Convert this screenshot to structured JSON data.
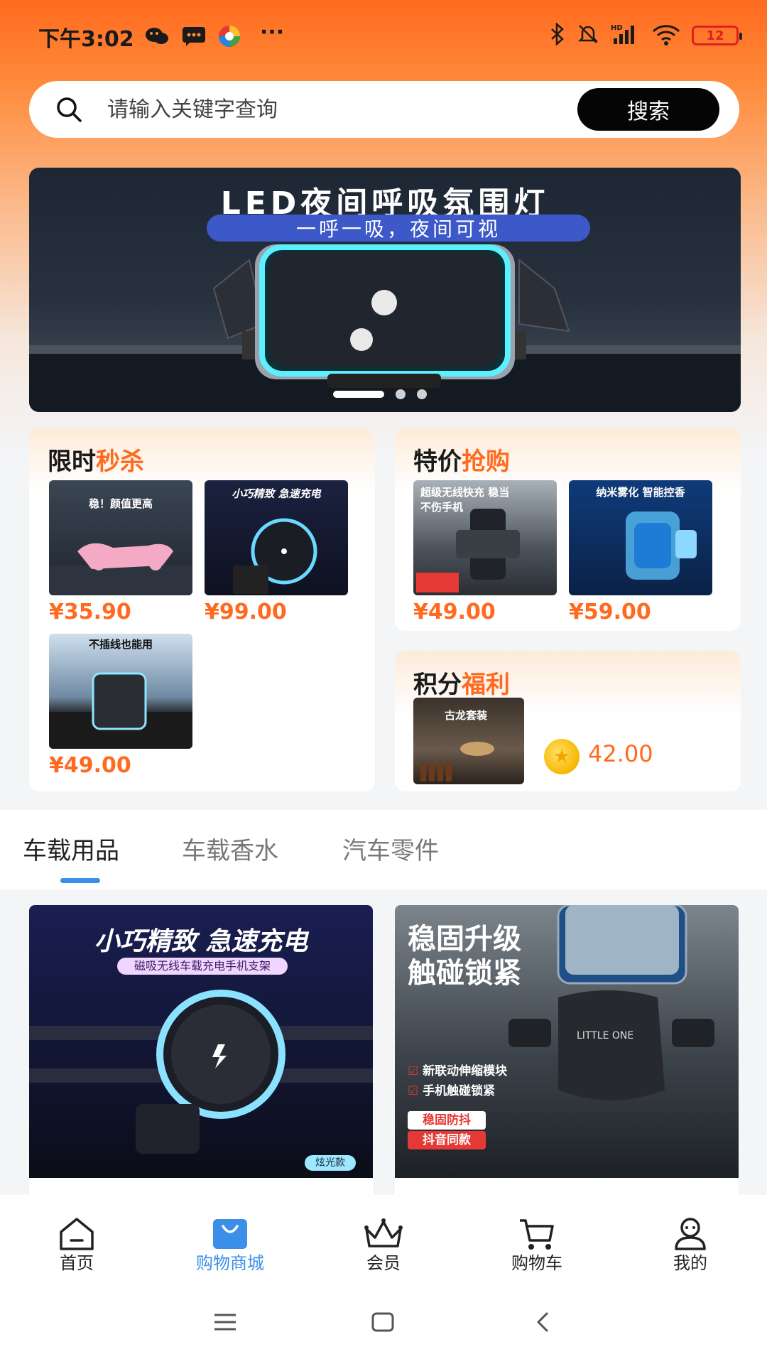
{
  "status_bar": {
    "time": "下午3:02",
    "more": "···",
    "battery": "12"
  },
  "search": {
    "placeholder": "请输入关键字查询",
    "button": "搜索"
  },
  "banner": {
    "title": "LED夜间呼吸氛围灯",
    "subtitle": "一呼一吸，夜间可视",
    "slides": 3,
    "active_slide": 1
  },
  "flash_sale": {
    "title_plain": "限时",
    "title_accent": "秒杀",
    "items": [
      {
        "caption": "稳！颜值更高",
        "price": "¥35.90"
      },
      {
        "caption": "小巧精致 急速充电",
        "price": "¥99.00"
      },
      {
        "caption": "不插线也能用",
        "price": "¥49.00"
      }
    ]
  },
  "special_price": {
    "title_plain": "特价",
    "title_accent": "抢购",
    "items": [
      {
        "caption": "超级无线快充 稳当不伤手机",
        "price": "¥49.00"
      },
      {
        "caption": "纳米雾化 智能控香",
        "price": "¥59.00"
      }
    ]
  },
  "points": {
    "title_plain": "积分",
    "title_accent": "福利",
    "item_caption": "古龙套装",
    "points_value": "42.00"
  },
  "tabs": [
    {
      "label": "车载用品",
      "active": true
    },
    {
      "label": "车载香水",
      "active": false
    },
    {
      "label": "汽车零件",
      "active": false
    }
  ],
  "products": [
    {
      "headline": "小巧精致 急速充电",
      "sub": "磁吸无线车载充电手机支架",
      "badge": "炫光款"
    },
    {
      "headline_1": "稳固升级",
      "headline_2": "触碰锁紧",
      "feature_1": "新联动伸缩模块",
      "feature_2": "手机触碰锁紧",
      "tag_1": "稳固防抖",
      "tag_2": "抖音同款",
      "brand": "LITTLE ONE"
    }
  ],
  "bottom_nav": [
    {
      "label": "首页",
      "icon": "home-icon",
      "active": false
    },
    {
      "label": "购物商城",
      "icon": "shopping-bag-icon",
      "active": true
    },
    {
      "label": "会员",
      "icon": "crown-icon",
      "active": false
    },
    {
      "label": "购物车",
      "icon": "cart-icon",
      "active": false
    },
    {
      "label": "我的",
      "icon": "profile-icon",
      "active": false
    }
  ],
  "colors": {
    "accent": "#ff6a1f",
    "nav_active": "#3b8fe8"
  }
}
